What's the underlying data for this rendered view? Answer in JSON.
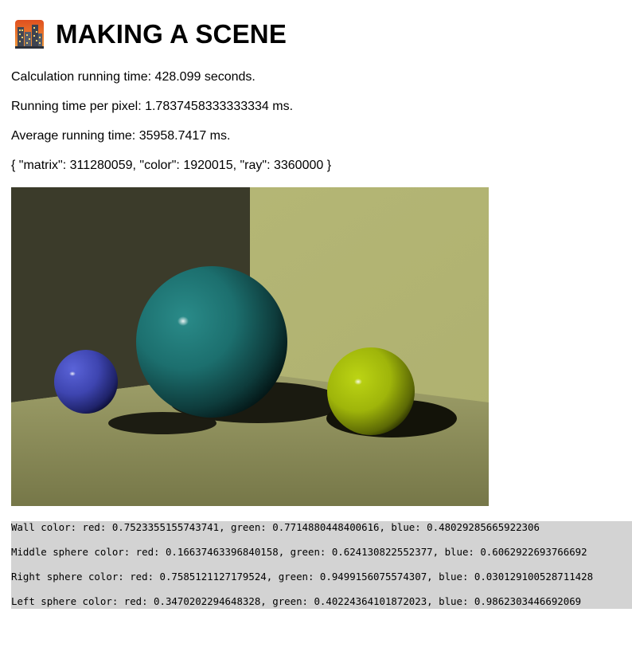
{
  "header": {
    "title": "MAKING A SCENE",
    "icon": "city-skyline-icon"
  },
  "stats": {
    "calc_time": "Calculation running time: 428.099 seconds.",
    "per_pixel": "Running time per pixel: 1.7837458333333334 ms.",
    "average": "Average running time: 35958.7417 ms.",
    "counts": "{ \"matrix\": 311280059, \"color\": 1920015, \"ray\": 3360000 }"
  },
  "scene": {
    "wall_color": "#b3b574",
    "shadow_wall_color": "#3b3b2a",
    "floor_color": "#8e8f56",
    "middle_sphere_color": "#1f7b7a",
    "right_sphere_color": "#aec70b",
    "left_sphere_color": "#4c54c8"
  },
  "colors": {
    "wall": "Wall color: red: 0.7523355155743741, green: 0.7714880448400616, blue: 0.48029285665922306",
    "middle": "Middle sphere color: red: 0.16637463396840158, green: 0.624130822552377, blue: 0.6062922693766692",
    "right": "Right sphere color: red: 0.7585121127179524, green: 0.9499156075574307, blue: 0.030129100528711428",
    "left": "Left sphere color: red: 0.3470202294648328, green: 0.40224364101872023, blue: 0.9862303446692069"
  }
}
